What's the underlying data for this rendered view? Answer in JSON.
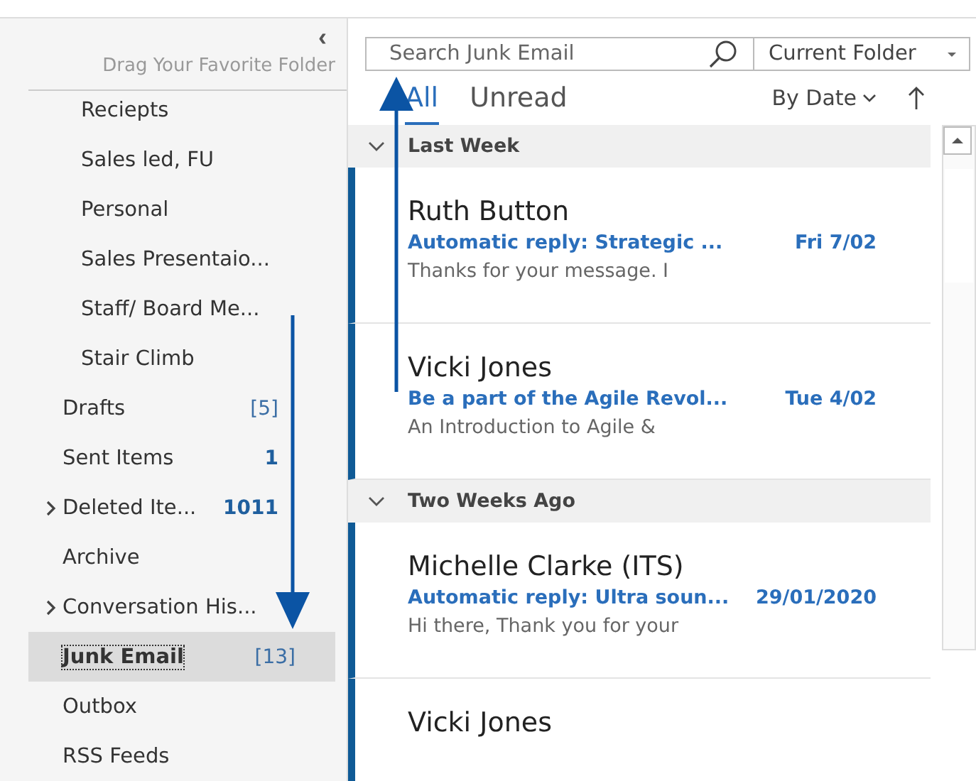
{
  "sidebar": {
    "collapse_glyph": "‹",
    "favorites_hint": "Drag Your Favorite Folder",
    "subfolders": [
      {
        "label": "Reciepts"
      },
      {
        "label": "Sales led, FU"
      },
      {
        "label": "Personal"
      },
      {
        "label": "Sales Presentaio..."
      },
      {
        "label": "Staff/ Board Me..."
      },
      {
        "label": "Stair Climb"
      }
    ],
    "folders": [
      {
        "label": "Drafts",
        "count": "[5]",
        "count_bold": false,
        "has_children": false,
        "selected": false
      },
      {
        "label": "Sent Items",
        "count": "1",
        "count_bold": true,
        "has_children": false,
        "selected": false
      },
      {
        "label": "Deleted Ite...",
        "count": "1011",
        "count_bold": true,
        "has_children": true,
        "selected": false
      },
      {
        "label": "Archive",
        "has_children": false,
        "selected": false
      },
      {
        "label": "Conversation His...",
        "has_children": true,
        "selected": false
      },
      {
        "label": "Junk Email",
        "count": "[13]",
        "count_bold": false,
        "has_children": false,
        "selected": true
      },
      {
        "label": "Outbox",
        "has_children": false,
        "selected": false
      },
      {
        "label": "RSS Feeds",
        "has_children": false,
        "selected": false
      }
    ]
  },
  "search": {
    "placeholder": "Search Junk Email",
    "scope": "Current Folder"
  },
  "tabs": [
    {
      "label": "All",
      "selected": true
    },
    {
      "label": "Unread",
      "selected": false
    }
  ],
  "sort": {
    "label": "By Date"
  },
  "groups": [
    {
      "label": "Last Week",
      "messages": [
        {
          "sender": "Ruth Button",
          "subject": "Automatic reply: Strategic ...",
          "date": "Fri 7/02",
          "preview": "Thanks for your message. I",
          "unread": true
        },
        {
          "sender": "Vicki Jones",
          "subject": "Be a part of the Agile Revol...",
          "date": "Tue 4/02",
          "preview": "An Introduction to Agile &",
          "unread": true
        }
      ]
    },
    {
      "label": "Two Weeks Ago",
      "messages": [
        {
          "sender": "Michelle Clarke (ITS)",
          "subject": "Automatic reply: Ultra soun...",
          "date": "29/01/2020",
          "preview": "Hi there,  Thank you for your",
          "unread": true
        },
        {
          "sender": "Vicki Jones",
          "unread": true
        }
      ]
    }
  ]
}
